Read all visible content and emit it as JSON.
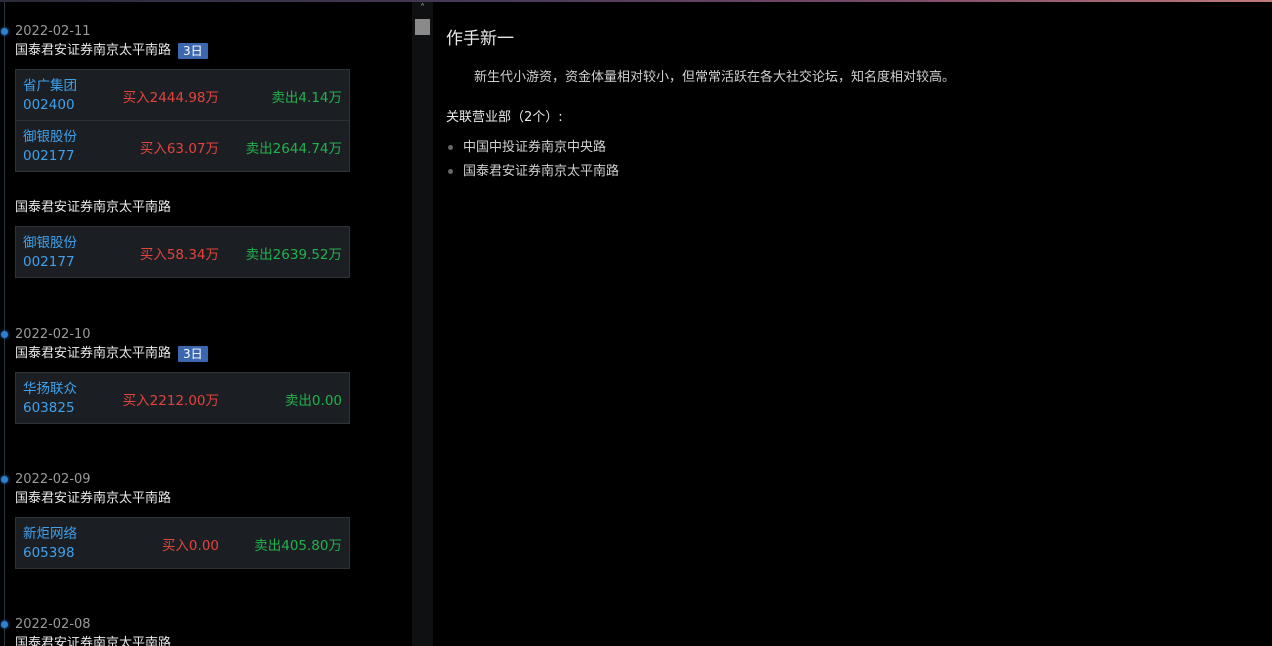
{
  "timeline": [
    {
      "date": "2022-02-11",
      "groups": [
        {
          "broker": "国泰君安证券南京太平南路",
          "badge": "3日",
          "rows": [
            {
              "name": "省广集团",
              "code": "002400",
              "buy": "买入2444.98万",
              "sell": "卖出4.14万"
            },
            {
              "name": "御银股份",
              "code": "002177",
              "buy": "买入63.07万",
              "sell": "卖出2644.74万"
            }
          ]
        },
        {
          "broker": "国泰君安证券南京太平南路",
          "badge": "",
          "rows": [
            {
              "name": "御银股份",
              "code": "002177",
              "buy": "买入58.34万",
              "sell": "卖出2639.52万"
            }
          ]
        }
      ]
    },
    {
      "date": "2022-02-10",
      "groups": [
        {
          "broker": "国泰君安证券南京太平南路",
          "badge": "3日",
          "rows": [
            {
              "name": "华扬联众",
              "code": "603825",
              "buy": "买入2212.00万",
              "sell": "卖出0.00"
            }
          ]
        }
      ]
    },
    {
      "date": "2022-02-09",
      "groups": [
        {
          "broker": "国泰君安证券南京太平南路",
          "badge": "",
          "rows": [
            {
              "name": "新炬网络",
              "code": "605398",
              "buy": "买入0.00",
              "sell": "卖出405.80万"
            }
          ]
        }
      ]
    },
    {
      "date": "2022-02-08",
      "groups": [
        {
          "broker": "国泰君安证券南京太平南路",
          "badge": "",
          "rows": []
        }
      ]
    }
  ],
  "detail": {
    "title": "作手新一",
    "description": "新生代小游资，资金体量相对较小，但常常活跃在各大社交论坛，知名度相对较高。",
    "related_label": "关联营业部（2个）:",
    "related": [
      "中国中投证券南京中央路",
      "国泰君安证券南京太平南路"
    ]
  },
  "colors": {
    "buy": "#e2443c",
    "sell": "#22b14c",
    "stock": "#3fa0ec",
    "badge": "#3a67b0",
    "timeline_dot": "#2f7fd0"
  },
  "icons": {
    "scroll_up": "chevron-up-icon",
    "bullet": "bullet-icon",
    "timeline_dot": "timeline-dot-icon"
  }
}
